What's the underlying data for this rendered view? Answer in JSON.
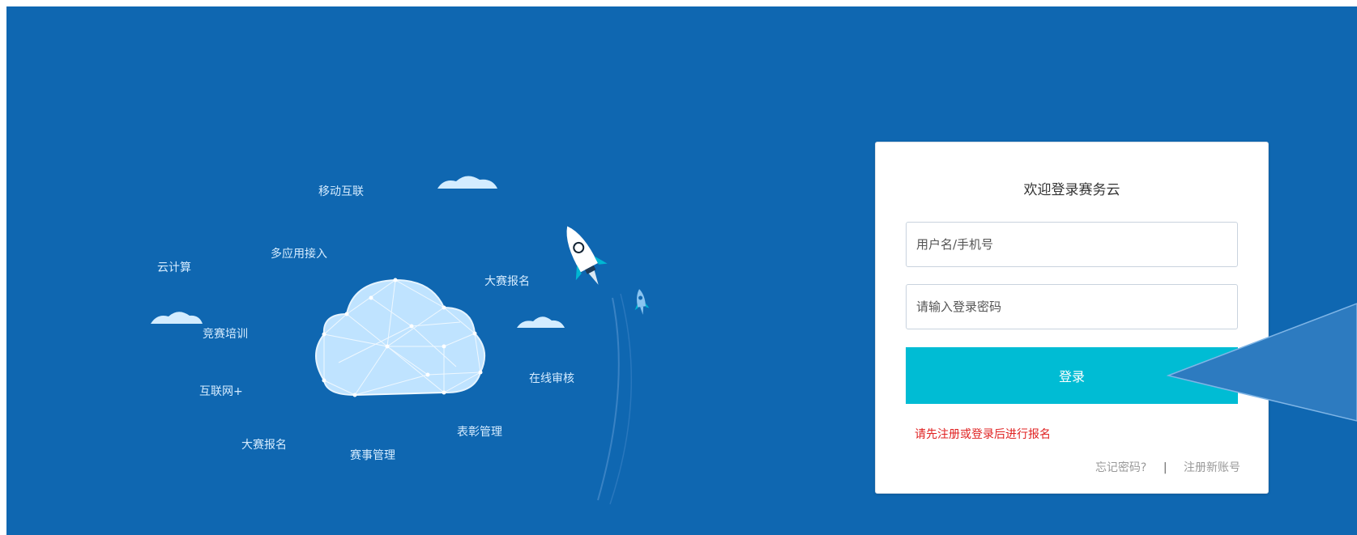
{
  "illustration": {
    "labels": {
      "mobile": "移动互联",
      "multi_app": "多应用接入",
      "cloud_computing": "云计算",
      "contest_signup_right": "大赛报名",
      "competition_training": "竞赛培训",
      "online_review": "在线审核",
      "internet_plus": "互联网+",
      "award_management": "表彰管理",
      "contest_signup_bottom": "大赛报名",
      "event_management": "赛事管理"
    }
  },
  "login": {
    "title": "欢迎登录赛务云",
    "username_placeholder": "用户名/手机号",
    "password_placeholder": "请输入登录密码",
    "submit_label": "登录",
    "notice": "请先注册或登录后进行报名",
    "forgot_label": "忘记密码?",
    "separator": "|",
    "register_label": "注册新账号"
  },
  "colors": {
    "banner_bg": "#0f67b1",
    "button": "#00bcd4",
    "notice": "#e02020"
  }
}
